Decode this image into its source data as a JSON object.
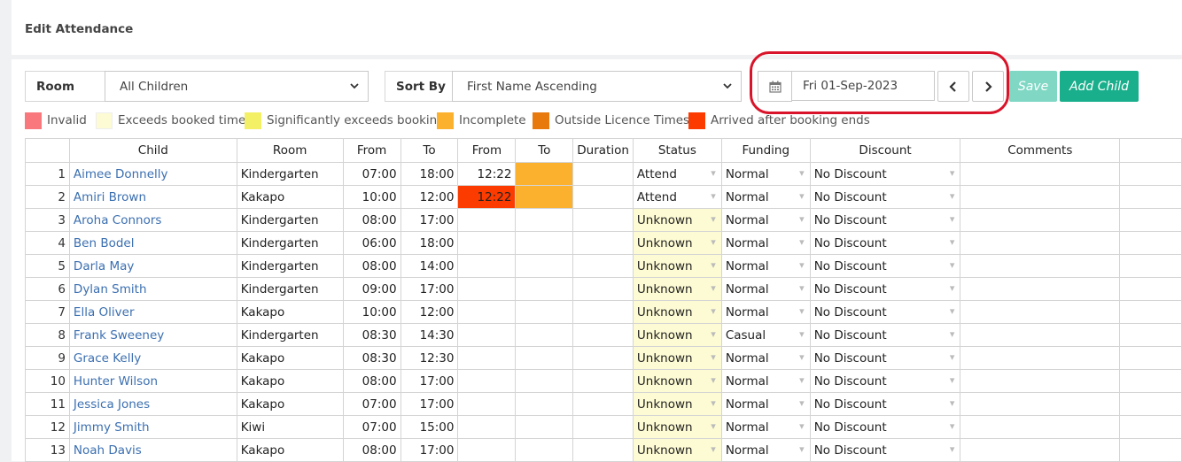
{
  "page": {
    "title": "Edit Attendance"
  },
  "controls": {
    "room_label": "Room",
    "room_value": "All Children",
    "sort_label": "Sort By",
    "sort_value": "First Name Ascending",
    "date_value": "Fri 01-Sep-2023",
    "save_label": "Save",
    "add_child_label": "Add Child"
  },
  "legend": [
    {
      "label": "Invalid",
      "color": "#f8787e"
    },
    {
      "label": "Exceeds booked time",
      "color": "#fdfbd3"
    },
    {
      "label": "Significantly exceeds booking",
      "color": "#f4f066"
    },
    {
      "label": "Incomplete",
      "color": "#fcb12e"
    },
    {
      "label": "Outside Licence Times",
      "color": "#e8790c"
    },
    {
      "label": "Arrived after booking ends",
      "color": "#fc3b00"
    }
  ],
  "table": {
    "headers": [
      "Child",
      "Room",
      "From",
      "To",
      "From",
      "To",
      "Duration",
      "Status",
      "Funding",
      "Discount",
      "Comments"
    ],
    "rows": [
      {
        "n": "1",
        "child": "Aimee Donnelly",
        "room": "Kindergarten",
        "from": "07:00",
        "to": "18:00",
        "afrom": "12:22",
        "ato": "",
        "dur": "",
        "status": "Attend",
        "funding": "Normal",
        "discount": "No Discount",
        "comments": ""
      },
      {
        "n": "2",
        "child": "Amiri Brown",
        "room": "Kakapo",
        "from": "10:00",
        "to": "12:00",
        "afrom": "12:22",
        "ato": "",
        "dur": "",
        "status": "Attend",
        "funding": "Normal",
        "discount": "No Discount",
        "comments": ""
      },
      {
        "n": "3",
        "child": "Aroha Connors",
        "room": "Kindergarten",
        "from": "08:00",
        "to": "17:00",
        "afrom": "",
        "ato": "",
        "dur": "",
        "status": "Unknown",
        "funding": "Normal",
        "discount": "No Discount",
        "comments": ""
      },
      {
        "n": "4",
        "child": "Ben Bodel",
        "room": "Kindergarten",
        "from": "06:00",
        "to": "18:00",
        "afrom": "",
        "ato": "",
        "dur": "",
        "status": "Unknown",
        "funding": "Normal",
        "discount": "No Discount",
        "comments": ""
      },
      {
        "n": "5",
        "child": "Darla May",
        "room": "Kindergarten",
        "from": "08:00",
        "to": "14:00",
        "afrom": "",
        "ato": "",
        "dur": "",
        "status": "Unknown",
        "funding": "Normal",
        "discount": "No Discount",
        "comments": ""
      },
      {
        "n": "6",
        "child": "Dylan Smith",
        "room": "Kindergarten",
        "from": "09:00",
        "to": "17:00",
        "afrom": "",
        "ato": "",
        "dur": "",
        "status": "Unknown",
        "funding": "Normal",
        "discount": "No Discount",
        "comments": ""
      },
      {
        "n": "7",
        "child": "Ella Oliver",
        "room": "Kakapo",
        "from": "10:00",
        "to": "12:00",
        "afrom": "",
        "ato": "",
        "dur": "",
        "status": "Unknown",
        "funding": "Normal",
        "discount": "No Discount",
        "comments": ""
      },
      {
        "n": "8",
        "child": "Frank Sweeney",
        "room": "Kindergarten",
        "from": "08:30",
        "to": "14:30",
        "afrom": "",
        "ato": "",
        "dur": "",
        "status": "Unknown",
        "funding": "Casual",
        "discount": "No Discount",
        "comments": ""
      },
      {
        "n": "9",
        "child": "Grace Kelly",
        "room": "Kakapo",
        "from": "08:30",
        "to": "12:30",
        "afrom": "",
        "ato": "",
        "dur": "",
        "status": "Unknown",
        "funding": "Normal",
        "discount": "No Discount",
        "comments": ""
      },
      {
        "n": "10",
        "child": "Hunter Wilson",
        "room": "Kakapo",
        "from": "08:00",
        "to": "17:00",
        "afrom": "",
        "ato": "",
        "dur": "",
        "status": "Unknown",
        "funding": "Normal",
        "discount": "No Discount",
        "comments": ""
      },
      {
        "n": "11",
        "child": "Jessica Jones",
        "room": "Kakapo",
        "from": "07:00",
        "to": "17:00",
        "afrom": "",
        "ato": "",
        "dur": "",
        "status": "Unknown",
        "funding": "Normal",
        "discount": "No Discount",
        "comments": ""
      },
      {
        "n": "12",
        "child": "Jimmy Smith",
        "room": "Kiwi",
        "from": "07:00",
        "to": "15:00",
        "afrom": "",
        "ato": "",
        "dur": "",
        "status": "Unknown",
        "funding": "Normal",
        "discount": "No Discount",
        "comments": ""
      },
      {
        "n": "13",
        "child": "Noah Davis",
        "room": "Kakapo",
        "from": "08:00",
        "to": "17:00",
        "afrom": "",
        "ato": "",
        "dur": "",
        "status": "Unknown",
        "funding": "Normal",
        "discount": "No Discount",
        "comments": ""
      }
    ]
  }
}
